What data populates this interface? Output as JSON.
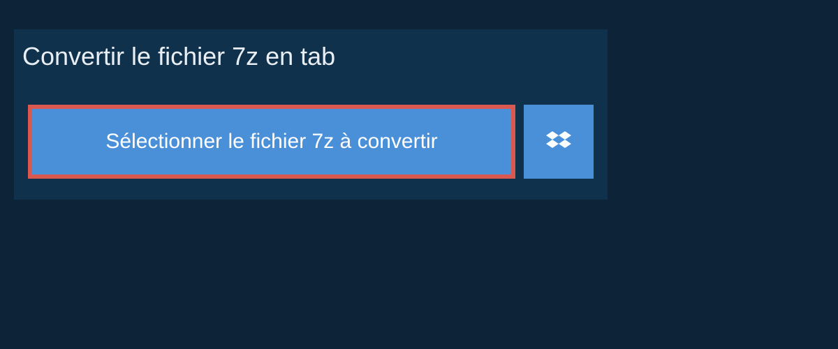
{
  "title": "Convertir le fichier 7z en tab",
  "select_button_label": "Sélectionner le fichier 7z à convertir",
  "colors": {
    "background": "#0d2438",
    "panel": "#10314b",
    "button": "#4a90d9",
    "highlight_border": "#d9584f"
  }
}
